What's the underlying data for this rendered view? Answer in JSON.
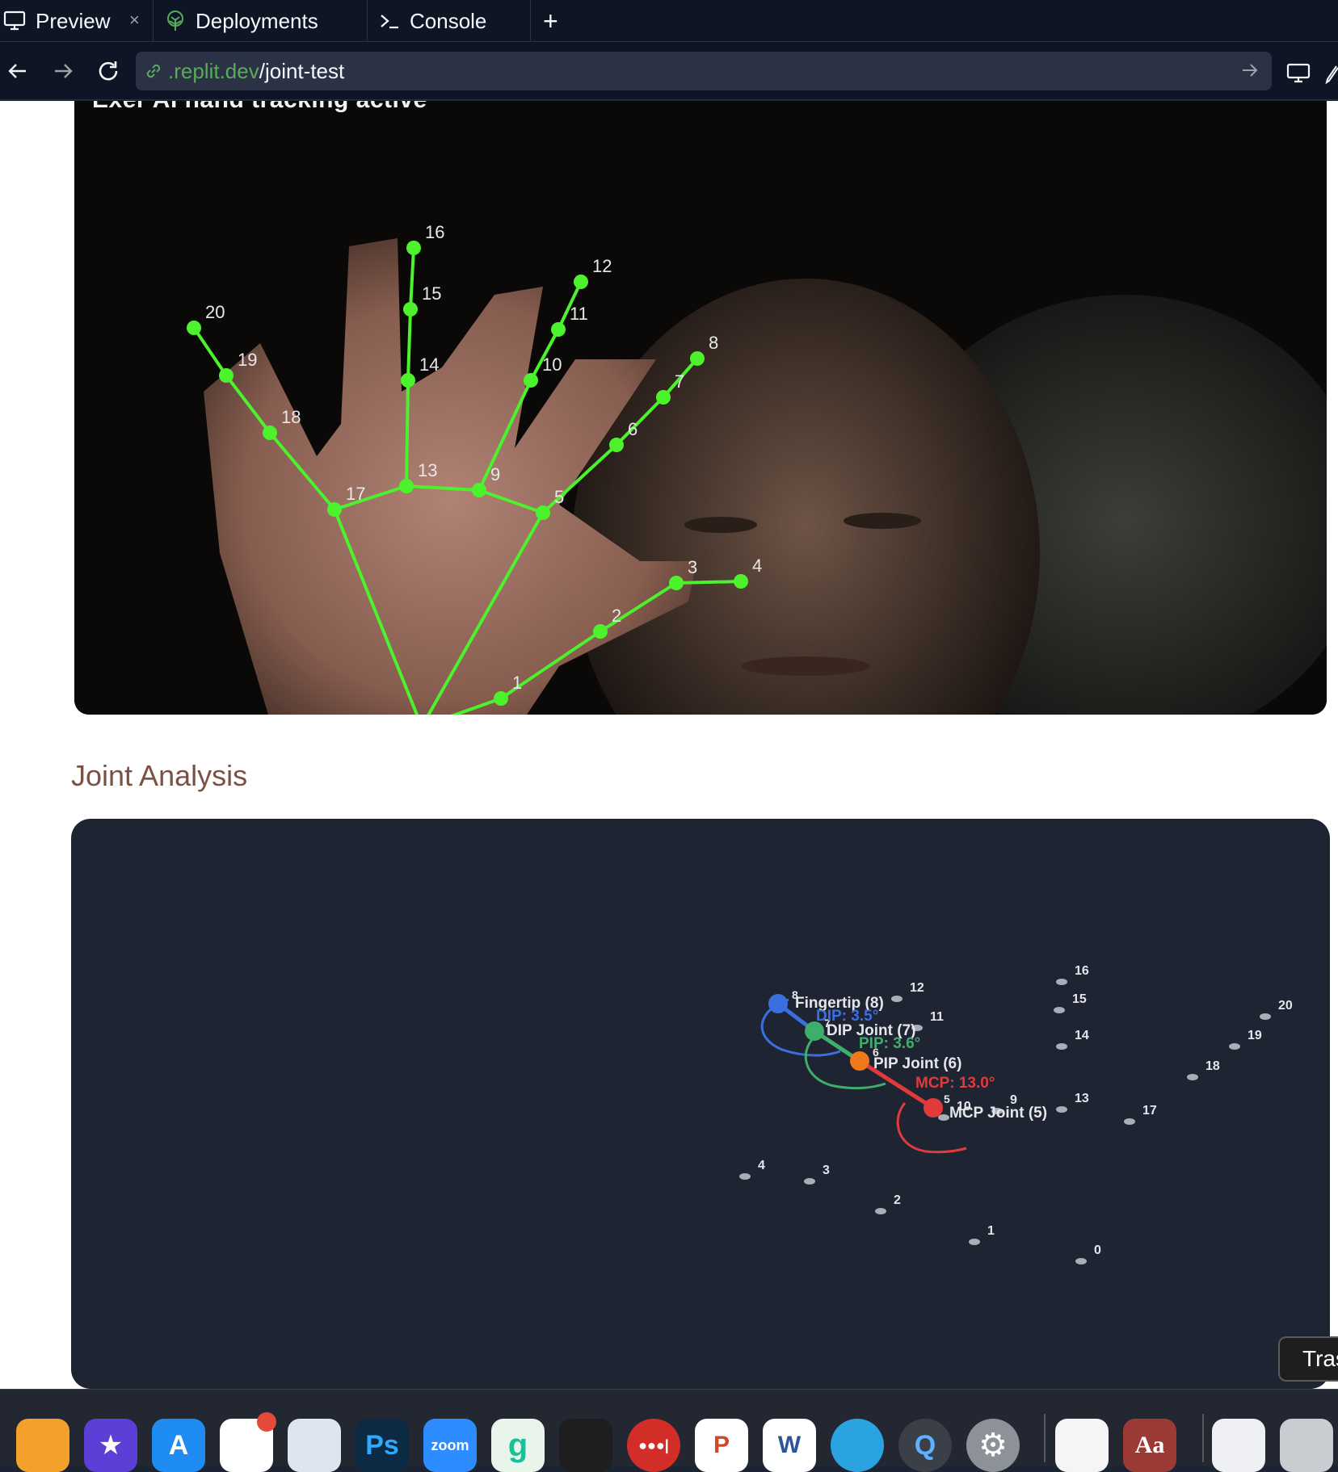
{
  "tabs": {
    "preview": "Preview",
    "deployments": "Deployments",
    "console": "Console",
    "close_glyph": "×",
    "new_tab_glyph": "+"
  },
  "address": {
    "host": ".replit.dev",
    "path": "/joint-test"
  },
  "video": {
    "caption": "Exer AI hand tracking active",
    "landmark_labels": [
      "1",
      "2",
      "3",
      "4",
      "5",
      "6",
      "7",
      "8",
      "9",
      "10",
      "11",
      "12",
      "13",
      "14",
      "15",
      "16",
      "17",
      "18",
      "19",
      "20"
    ]
  },
  "section_title": "Joint Analysis",
  "analysis": {
    "joint_labels": {
      "fingertip": "Fingertip (8)",
      "dip_joint": "DIP Joint (7)",
      "pip_joint": "PIP Joint (6)",
      "mcp_joint": "MCP Joint (5)"
    },
    "angle_labels": {
      "dip": "DIP: 3.5°",
      "pip": "PIP: 3.6°",
      "mcp": "MCP: 13.0°"
    },
    "landmark_labels": [
      "0",
      "1",
      "2",
      "3",
      "4",
      "5",
      "6",
      "7",
      "8",
      "9",
      "10",
      "11",
      "12",
      "13",
      "14",
      "15",
      "16",
      "17",
      "18",
      "19",
      "20"
    ],
    "colors": {
      "fingertip": "#3b6fe0",
      "dip": "#3fae6a",
      "pip": "#f07a1a",
      "mcp": "#e23a3a"
    }
  },
  "tooltip": "Tras",
  "dock": {
    "apps": [
      {
        "name": "pages",
        "label": ""
      },
      {
        "name": "imovie",
        "label": "★"
      },
      {
        "name": "app-store",
        "label": "A"
      },
      {
        "name": "slack",
        "label": ""
      },
      {
        "name": "preview",
        "label": ""
      },
      {
        "name": "photoshop",
        "label": "Ps"
      },
      {
        "name": "zoom",
        "label": "zoom"
      },
      {
        "name": "grammarly",
        "label": "g"
      },
      {
        "name": "figma",
        "label": ""
      },
      {
        "name": "lastpass",
        "label": "●●●|"
      },
      {
        "name": "powerpoint",
        "label": "P"
      },
      {
        "name": "word",
        "label": "W"
      },
      {
        "name": "telegram",
        "label": ""
      },
      {
        "name": "quicktime",
        "label": "Q"
      },
      {
        "name": "system-settings",
        "label": "⚙"
      },
      {
        "name": "textedit",
        "label": ""
      },
      {
        "name": "dictionary",
        "label": "Aa"
      },
      {
        "name": "documents",
        "label": ""
      },
      {
        "name": "trash",
        "label": ""
      }
    ]
  }
}
